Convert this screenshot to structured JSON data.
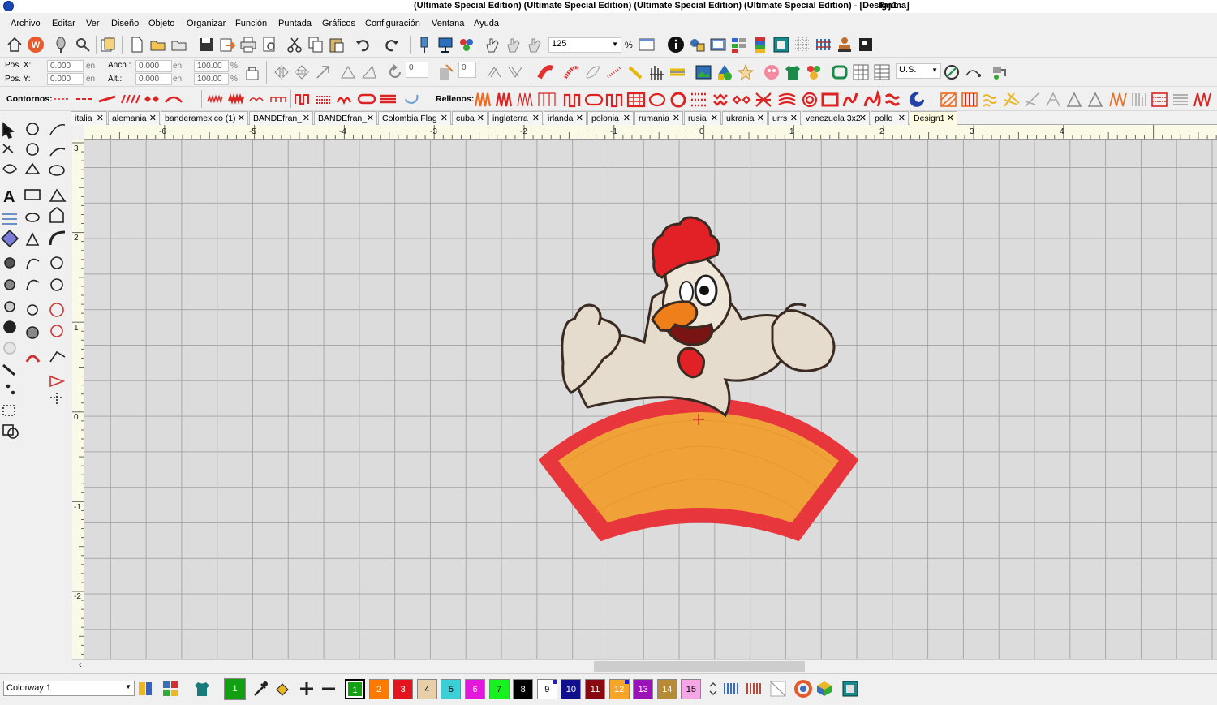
{
  "window": {
    "title": "(Ultimate Special Edition) (Ultimate Special Edition) (Ultimate Special Edition) (Ultimate Special Edition) - [Design1",
    "title_suffix": "Tajima]"
  },
  "menu": [
    "Archivo",
    "Editar",
    "Ver",
    "Diseño",
    "Objeto",
    "Organizar",
    "Función",
    "Puntada",
    "Gráficos",
    "Configuración",
    "Ventana",
    "Ayuda"
  ],
  "toolbar": {
    "zoom_value": "125",
    "zoom_unit": "%",
    "units_value": "U.S.",
    "stitch_count_value": "0"
  },
  "position": {
    "pos_x_label": "Pos. X:",
    "pos_x_value": "0.000",
    "pos_x_unit": "en",
    "pos_y_label": "Pos. Y:",
    "pos_y_value": "0.000",
    "pos_y_unit": "en",
    "width_label": "Anch.:",
    "width_value": "0.000",
    "width_unit": "en",
    "height_label": "Alt.:",
    "height_value": "0.000",
    "height_unit": "en",
    "scale_x_value": "100.00",
    "scale_x_unit": "%",
    "scale_y_value": "100.00",
    "scale_y_unit": "%"
  },
  "stitch_bar": {
    "outlines_label": "Contornos:",
    "fills_label": "Rellenos:"
  },
  "tabs": [
    {
      "label": "italia"
    },
    {
      "label": "alemania"
    },
    {
      "label": "banderamexico (1)"
    },
    {
      "label": "BANDEfran_"
    },
    {
      "label": "BANDEfran_"
    },
    {
      "label": "Colombia Flag"
    },
    {
      "label": "cuba"
    },
    {
      "label": "inglaterra"
    },
    {
      "label": "irlanda"
    },
    {
      "label": "polonia"
    },
    {
      "label": "rumania"
    },
    {
      "label": "rusia"
    },
    {
      "label": "ukrania"
    },
    {
      "label": "urrs"
    },
    {
      "label": "venezuela 3x2"
    },
    {
      "label": "pollo"
    },
    {
      "label": "Design1"
    }
  ],
  "active_tab": "Design1",
  "ruler": {
    "h_labels": [
      "-6",
      "-5",
      "-4",
      "-3",
      "-2",
      "-1",
      "0",
      "1",
      "2",
      "3",
      "4"
    ],
    "v_labels": [
      "3",
      "2",
      "1",
      "0",
      "-1",
      "-2"
    ]
  },
  "colorway": {
    "value": "Colorway 1"
  },
  "palette": [
    {
      "num": "1",
      "color": "#12a012",
      "text": "#ffffff",
      "selected": true
    },
    {
      "num": "2",
      "color": "#ff7a00",
      "text": "#ffffff"
    },
    {
      "num": "3",
      "color": "#e3141c",
      "text": "#ffffff"
    },
    {
      "num": "4",
      "color": "#e9cfa8",
      "text": "#000000"
    },
    {
      "num": "5",
      "color": "#3ccfd6",
      "text": "#000000"
    },
    {
      "num": "6",
      "color": "#e418dd",
      "text": "#ffffff"
    },
    {
      "num": "7",
      "color": "#17f11d",
      "text": "#000000"
    },
    {
      "num": "8",
      "color": "#000000",
      "text": "#ffffff"
    },
    {
      "num": "9",
      "color": "#ffffff",
      "text": "#000000"
    },
    {
      "num": "10",
      "color": "#10108c",
      "text": "#ffffff"
    },
    {
      "num": "11",
      "color": "#880a10",
      "text": "#ffffff"
    },
    {
      "num": "12",
      "color": "#f6a528",
      "text": "#ffffff"
    },
    {
      "num": "13",
      "color": "#9a12b8",
      "text": "#ffffff"
    },
    {
      "num": "14",
      "color": "#b78a35",
      "text": "#ffffff"
    },
    {
      "num": "15",
      "color": "#f5a6e6",
      "text": "#000000"
    }
  ],
  "current_color": {
    "num": "1",
    "color": "#12a012"
  },
  "accent_colors": {
    "stitch_red": "#e3312f",
    "banner_fill": "#f0a238",
    "banner_border": "#e8373c",
    "grid_bg": "#dcdcdc"
  }
}
